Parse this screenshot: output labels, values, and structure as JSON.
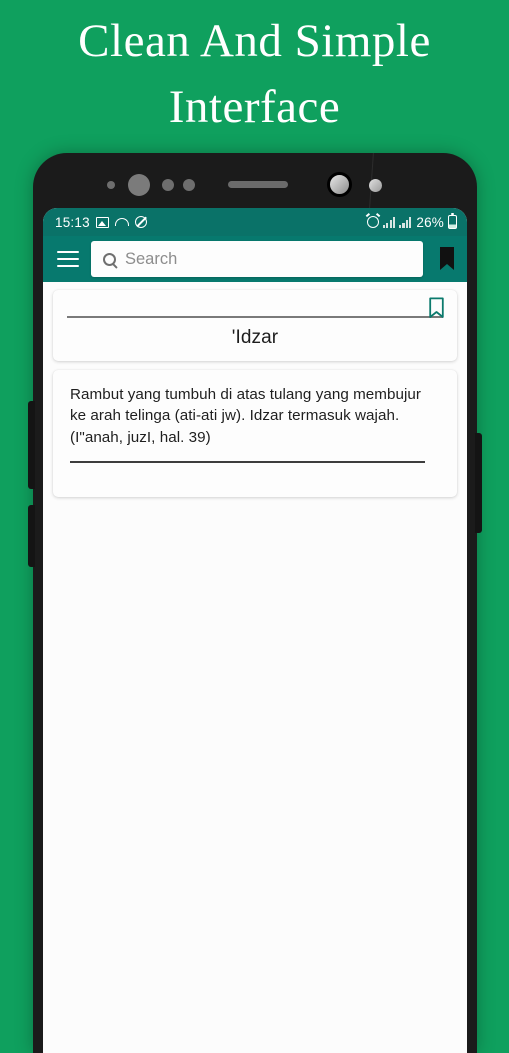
{
  "promo": {
    "heading": "Clean And Simple\nInterface"
  },
  "colors": {
    "background_green": "#0FA05E",
    "toolbar_teal": "#07796E",
    "statusbar_teal": "#0A7268",
    "card_background": "#FDFDFD",
    "bookmark_outline_teal": "#0C7A6D",
    "bookmark_filled_black": "#111111"
  },
  "phone": {
    "statusbar": {
      "time": "15:13",
      "left_icons": [
        "image-icon",
        "cloud-icon",
        "shield-block-icon"
      ],
      "right_icons": [
        "alarm-icon",
        "signal-bars-icon",
        "signal-bars-icon",
        "battery-icon"
      ],
      "battery_percent": "26%"
    },
    "toolbar": {
      "menu_icon": "hamburger-menu-icon",
      "search_placeholder": "Search",
      "search_value": "",
      "search_icon": "search-icon",
      "bookmark_icon": "bookmark-filled-icon"
    },
    "cards": {
      "title_card": {
        "bookmark_icon": "bookmark-outline-icon",
        "title": "'Idzar"
      },
      "definition_card": {
        "text": "Rambut yang tumbuh di atas tulang yang membujur ke arah telinga (ati-ati jw). Idzar termasuk wajah. (I\"anah, juzI, hal. 39)"
      }
    }
  }
}
